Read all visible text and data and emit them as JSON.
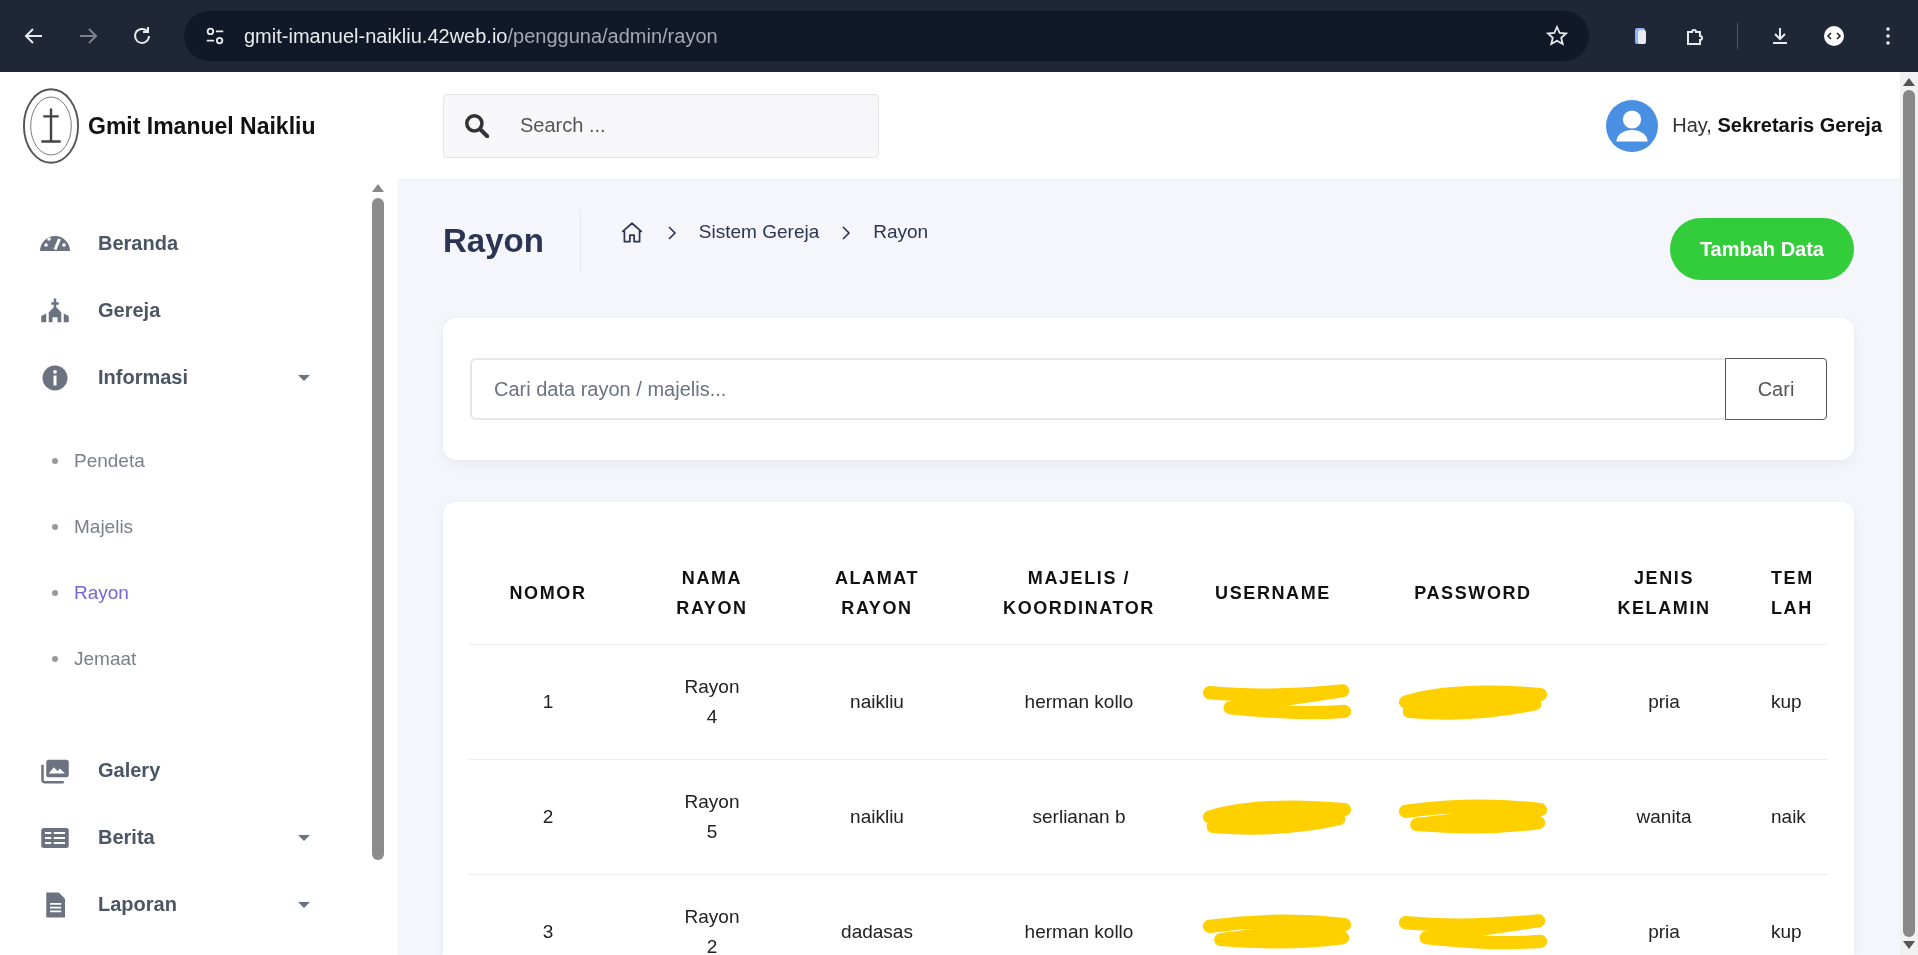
{
  "browser": {
    "url_host": "gmit-imanuel-naikliu.42web.io",
    "url_path": "/pengguna/admin/rayon"
  },
  "sidebar": {
    "brand": "Gmit Imanuel Naikliu",
    "items": [
      {
        "label": "Beranda",
        "expandable": false
      },
      {
        "label": "Gereja",
        "expandable": false
      },
      {
        "label": "Informasi",
        "expandable": true,
        "children": [
          {
            "label": "Pendeta",
            "selected": false
          },
          {
            "label": "Majelis",
            "selected": false
          },
          {
            "label": "Rayon",
            "selected": true
          },
          {
            "label": "Jemaat",
            "selected": false
          }
        ]
      },
      {
        "label": "Galery",
        "expandable": false
      },
      {
        "label": "Berita",
        "expandable": true
      },
      {
        "label": "Laporan",
        "expandable": true
      }
    ]
  },
  "header": {
    "search_placeholder": "Search ...",
    "greeting": "Hay, **Sekretaris Gereja**"
  },
  "page": {
    "title": "Rayon",
    "breadcrumb": [
      "Sistem Gereja",
      "Rayon"
    ],
    "add_button": "Tambah Data"
  },
  "filter": {
    "placeholder": "Cari data rayon / majelis...",
    "button": "Cari"
  },
  "table": {
    "columns": [
      "NOMOR",
      "NAMA\nRAYON",
      "ALAMAT\nRAYON",
      "MAJELIS /\nKOORDINATOR",
      "USERNAME",
      "PASSWORD",
      "JENIS\nKELAMIN",
      "TEM\nLAH"
    ],
    "rows": [
      {
        "cells": [
          {
            "kind": "text",
            "text": "1"
          },
          {
            "kind": "text",
            "text": "Rayon\n4"
          },
          {
            "kind": "text",
            "text": "naikliu"
          },
          {
            "kind": "text",
            "text": "herman kollo"
          },
          {
            "kind": "redacted"
          },
          {
            "kind": "redacted"
          },
          {
            "kind": "text",
            "text": "pria"
          },
          {
            "kind": "text",
            "text": "kup"
          }
        ]
      },
      {
        "cells": [
          {
            "kind": "text",
            "text": "2"
          },
          {
            "kind": "text",
            "text": "Rayon\n5"
          },
          {
            "kind": "text",
            "text": "naikliu"
          },
          {
            "kind": "text",
            "text": "serlianan b"
          },
          {
            "kind": "redacted"
          },
          {
            "kind": "redacted"
          },
          {
            "kind": "text",
            "text": "wanita"
          },
          {
            "kind": "text",
            "text": "naik"
          }
        ]
      },
      {
        "cells": [
          {
            "kind": "text",
            "text": "3"
          },
          {
            "kind": "text",
            "text": "Rayon\n2"
          },
          {
            "kind": "text",
            "text": "dadasas"
          },
          {
            "kind": "text",
            "text": "herman kollo"
          },
          {
            "kind": "redacted"
          },
          {
            "kind": "redacted"
          },
          {
            "kind": "text",
            "text": "pria"
          },
          {
            "kind": "text",
            "text": "kup"
          }
        ]
      }
    ]
  }
}
